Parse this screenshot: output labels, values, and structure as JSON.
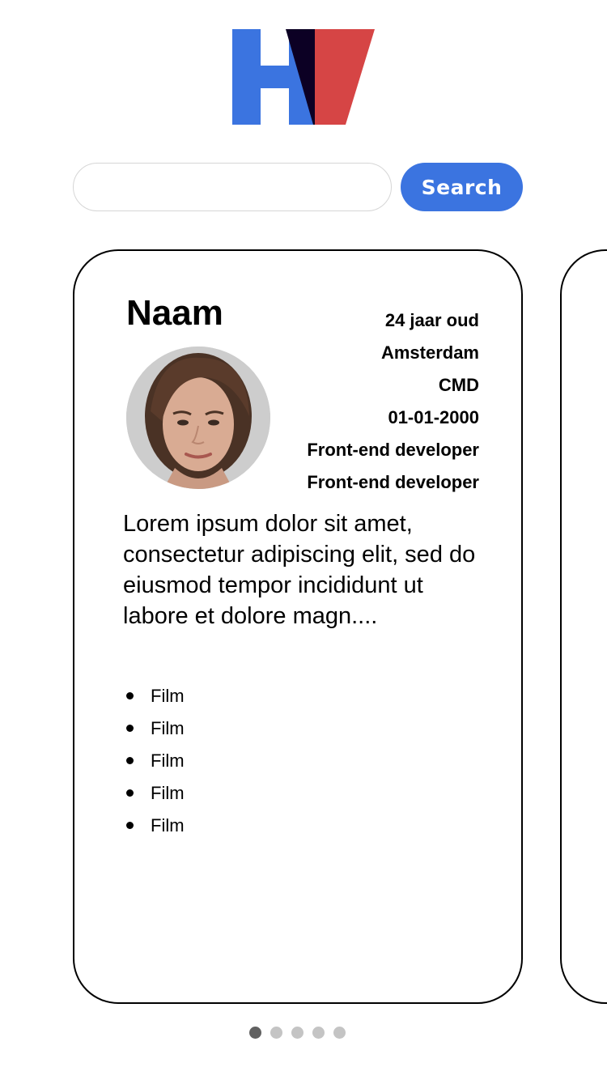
{
  "brand": {
    "logo": "HV-logo",
    "colors": {
      "blue": "#3b74e0",
      "navy": "#0c0024",
      "red": "#d64545"
    }
  },
  "search": {
    "placeholder": "",
    "value": "",
    "button_label": "Search"
  },
  "profile_card": {
    "name": "Naam",
    "avatar": "woman-portrait",
    "details": [
      "24 jaar oud",
      "Amsterdam",
      "CMD",
      "01-01-2000",
      "Front-end developer",
      "Front-end developer"
    ],
    "bio": "Lorem ipsum dolor sit amet, consectetur adipiscing elit, sed do eiusmod tempor incididunt ut labore et dolore magn....",
    "hobbies": [
      "Film",
      "Film",
      "Film",
      "Film",
      "Film"
    ]
  },
  "pagination": {
    "total": 5,
    "active": 1
  }
}
